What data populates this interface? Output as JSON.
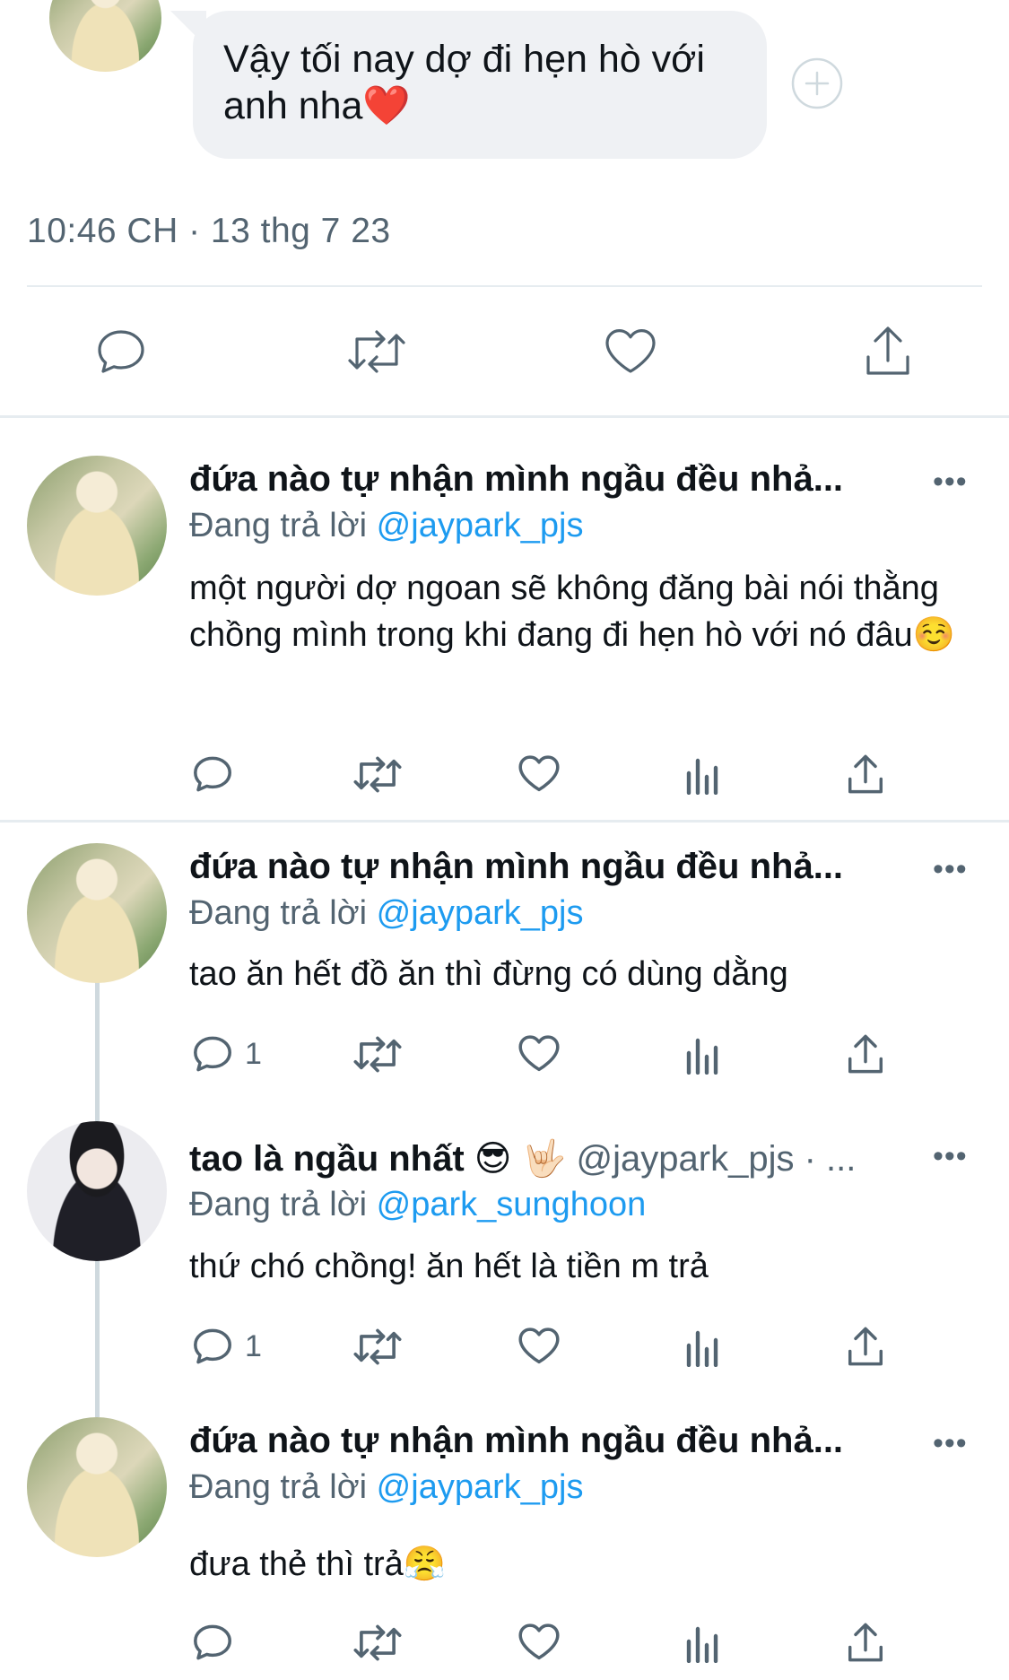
{
  "dm": {
    "message": "Vậy tối nay dợ đi hẹn hò với anh nha❤️",
    "timestamp": "10:46 CH · 13 thg 7 23"
  },
  "replies": [
    {
      "name": "đứa nào tự nhận mình ngầu đều nhả...",
      "reply_prefix": "Đang trả lời",
      "reply_to": "@jaypark_pjs",
      "text": "một người dợ ngoan sẽ không đăng bài nói thằng chồng mình trong khi đang đi hẹn hò với nó đâu☺️",
      "reply_count": ""
    },
    {
      "name": "đứa nào tự nhận mình ngầu đều nhả...",
      "reply_prefix": "Đang trả lời",
      "reply_to": "@jaypark_pjs",
      "text": "tao ăn hết đồ ăn thì đừng có dùng dằng",
      "reply_count": "1"
    },
    {
      "name": "tao là ngầu nhất 😎 🤟🏻",
      "handle": "@jaypark_pjs · ...",
      "reply_prefix": "Đang trả lời",
      "reply_to": "@park_sunghoon",
      "text": "thứ chó chồng! ăn hết là tiền m trả",
      "reply_count": "1"
    },
    {
      "name": "đứa nào tự nhận mình ngầu đều nhả...",
      "reply_prefix": "Đang trả lời",
      "reply_to": "@jaypark_pjs",
      "text": "đưa thẻ thì trả😤",
      "reply_count": ""
    }
  ],
  "more_label": "•••",
  "icons": [
    "reply-icon",
    "retweet-icon",
    "like-icon",
    "views-icon",
    "share-icon",
    "add-reaction-icon"
  ],
  "colors": {
    "mention": "#1d9bf0",
    "secondary": "#536471",
    "bubble": "#eff1f4",
    "divider": "#e6ecf0"
  }
}
